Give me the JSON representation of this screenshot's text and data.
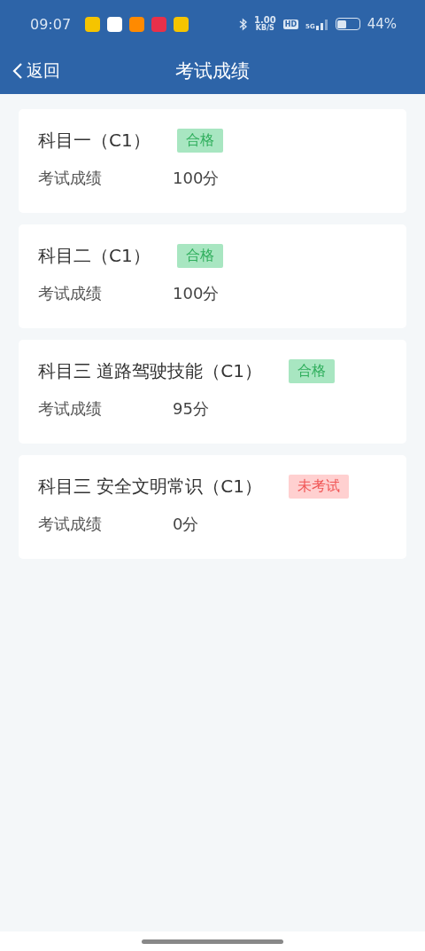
{
  "status_bar": {
    "time": "09:07",
    "app_icons": [
      {
        "color": "#f5c400"
      },
      {
        "color": "#ffffff"
      },
      {
        "color": "#ff8a00"
      },
      {
        "color": "#e8304a"
      },
      {
        "color": "#f5c400"
      }
    ],
    "net_speed": "1.00",
    "net_unit": "KB/S",
    "hd": "HD",
    "network": "5G",
    "battery": "44%"
  },
  "nav": {
    "back": "返回",
    "title": "考试成绩"
  },
  "results": [
    {
      "subject": "科目一（C1）",
      "status": {
        "kind": "pass",
        "label": "合格"
      },
      "score_label": "考试成绩",
      "score": "100分"
    },
    {
      "subject": "科目二（C1）",
      "status": {
        "kind": "pass",
        "label": "合格"
      },
      "score_label": "考试成绩",
      "score": "100分"
    },
    {
      "subject": "科目三 道路驾驶技能（C1）",
      "status": {
        "kind": "pass",
        "label": "合格"
      },
      "score_label": "考试成绩",
      "score": "95分"
    },
    {
      "subject": "科目三 安全文明常识（C1）",
      "status": {
        "kind": "pending",
        "label": "未考试"
      },
      "score_label": "考试成绩",
      "score": "0分"
    }
  ]
}
